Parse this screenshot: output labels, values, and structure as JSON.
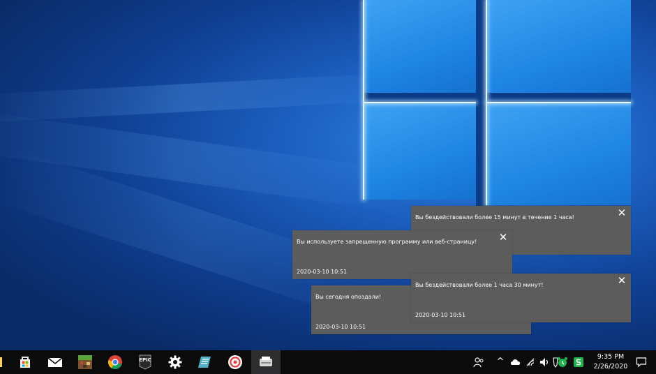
{
  "toasts": [
    {
      "message": "Вы бездействовали более 15 минут в течение 1 часа!",
      "time": "",
      "close": "✕"
    },
    {
      "message": "Вы используете запрещенную программу или веб-страницу!",
      "time": "2020-03-10 10:51",
      "close": "✕"
    },
    {
      "message": "Вы сегодня опоздали!",
      "time": "2020-03-10 10:51",
      "close": ""
    },
    {
      "message": "Вы бездействовали более 1 часа 30 минут!",
      "time": "2020-03-10 10:51",
      "close": "✕"
    }
  ],
  "taskbar": {
    "apps": [
      {
        "icon": "microsoft-store-icon"
      },
      {
        "icon": "mail-icon"
      },
      {
        "icon": "minecraft-icon"
      },
      {
        "icon": "chrome-icon"
      },
      {
        "icon": "epic-games-icon",
        "label": "EPIC"
      },
      {
        "icon": "settings-gear-icon"
      },
      {
        "icon": "notepad-app-icon"
      },
      {
        "icon": "red-circle-app-icon"
      },
      {
        "icon": "scanner-app-icon"
      }
    ],
    "tray": {
      "people_icon": "people-icon",
      "chevron": "^",
      "clock_time": "9:35 PM",
      "clock_date": "2/26/2020"
    }
  },
  "colors": {
    "toast_bg": "#5c5c5c",
    "taskbar_bg": "#0b0b0c",
    "desktop_accent": "#1e86e3"
  }
}
